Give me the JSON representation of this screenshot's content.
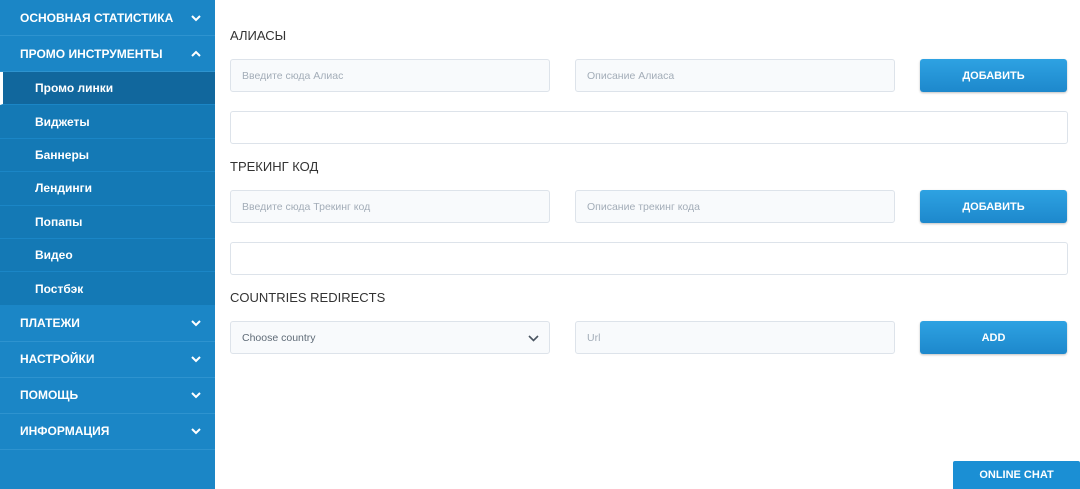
{
  "sidebar": {
    "top_items": [
      {
        "label": "ОСНОВНАЯ СТАТИСТИКА",
        "expanded": false
      },
      {
        "label": "ПРОМО ИНСТРУМЕНТЫ",
        "expanded": true
      }
    ],
    "submenu": [
      {
        "label": "Промо линки",
        "active": true
      },
      {
        "label": "Виджеты"
      },
      {
        "label": "Баннеры"
      },
      {
        "label": "Лендинги"
      },
      {
        "label": "Попапы"
      },
      {
        "label": "Видео"
      },
      {
        "label": "Постбэк"
      }
    ],
    "bottom_items": [
      {
        "label": "ПЛАТЕЖИ"
      },
      {
        "label": "НАСТРОЙКИ"
      },
      {
        "label": "ПОМОЩЬ"
      },
      {
        "label": "ИНФОРМАЦИЯ"
      }
    ]
  },
  "aliases": {
    "title": "АЛИАСЫ",
    "alias_placeholder": "Введите сюда Алиас",
    "description_placeholder": "Описание Алиаса",
    "button": "ДОБАВИТЬ"
  },
  "tracking": {
    "title": "ТРЕКИНГ КОД",
    "code_placeholder": "Введите сюда Трекинг код",
    "description_placeholder": "Описание трекинг кода",
    "button": "ДОБАВИТЬ"
  },
  "redirects": {
    "title": "COUNTRIES REDIRECTS",
    "country_placeholder": "Choose country",
    "url_placeholder": "Url",
    "button": "ADD"
  },
  "chat": {
    "label": "ONLINE CHAT"
  },
  "colors": {
    "sidebar": "#1b86c6",
    "accent": "#1d88cc"
  }
}
